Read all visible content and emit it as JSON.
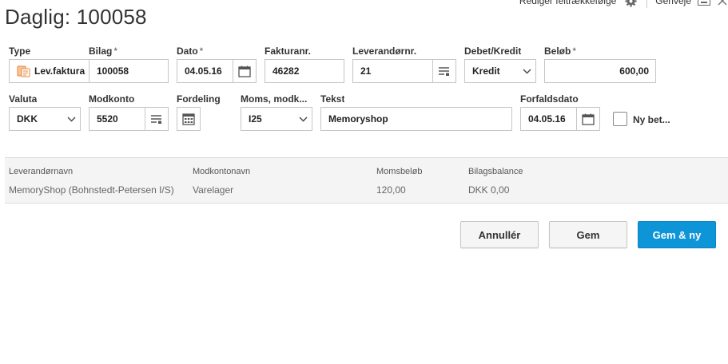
{
  "header": {
    "title": "Daglig: 100058",
    "edit_field_order_link": "Rediger feltrækkefølge",
    "shortcuts_link": "Genveje"
  },
  "form": {
    "type": {
      "label": "Type",
      "value": "Lev.faktura"
    },
    "bilag": {
      "label": "Bilag",
      "required": "*",
      "value": "100058"
    },
    "dato": {
      "label": "Dato",
      "required": "*",
      "value": "04.05.16"
    },
    "fakturanr": {
      "label": "Fakturanr.",
      "value": "46282"
    },
    "leverandornr": {
      "label": "Leverandørnr.",
      "value": "21"
    },
    "debet_kredit": {
      "label": "Debet/Kredit",
      "value": "Kredit"
    },
    "belob": {
      "label": "Beløb",
      "required": "*",
      "value": "600,00"
    },
    "valuta": {
      "label": "Valuta",
      "value": "DKK"
    },
    "modkonto": {
      "label": "Modkonto",
      "value": "5520"
    },
    "fordeling": {
      "label": "Fordeling"
    },
    "moms": {
      "label": "Moms, modk...",
      "value": "I25"
    },
    "tekst": {
      "label": "Tekst",
      "value": "Memoryshop"
    },
    "forfaldsdato": {
      "label": "Forfaldsdato",
      "value": "04.05.16"
    },
    "ny_bet": {
      "label": "Ny bet...",
      "checked": false
    }
  },
  "info": {
    "headers": [
      "Leverandørnavn",
      "Modkontonavn",
      "Momsbeløb",
      "Bilagsbalance"
    ],
    "values": [
      "MemoryShop (Bohnstedt-Petersen I/S)",
      "Varelager",
      "120,00",
      "DKK 0,00"
    ]
  },
  "actions": {
    "cancel": "Annullér",
    "save": "Gem",
    "save_new": "Gem & ny"
  },
  "colors": {
    "primary": "#0d95d8",
    "type_icon": "#e8833a"
  }
}
